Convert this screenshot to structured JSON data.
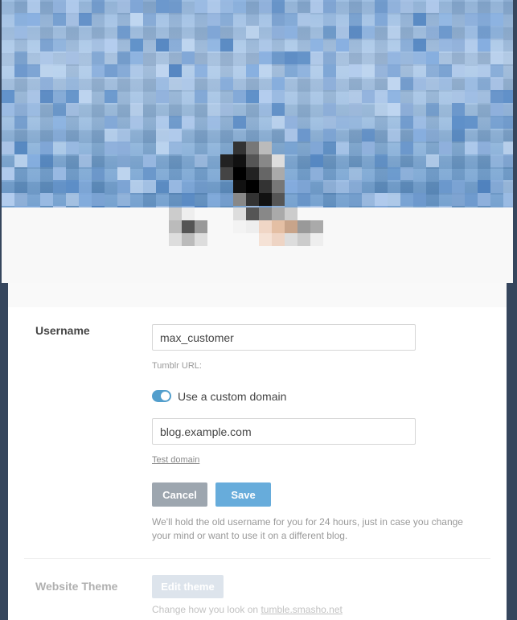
{
  "header": {
    "image_alt": "header image",
    "accent_color": "#529ecc"
  },
  "username_section": {
    "label": "Username",
    "value": "max_customer",
    "tumblr_url_label": "Tumblr URL:",
    "custom_domain_toggle_label": "Use a custom domain",
    "custom_domain_enabled": true,
    "domain_value": "blog.example.com",
    "test_domain_link": "Test domain",
    "cancel_label": "Cancel",
    "save_label": "Save",
    "note": "We'll hold the old username for you for 24 hours, just in case you change your mind or want to use it on a different blog."
  },
  "theme_section": {
    "label": "Website Theme",
    "edit_button_label": "Edit theme",
    "note_prefix": "Change how you look on ",
    "note_link": "tumble.smasho.net"
  }
}
